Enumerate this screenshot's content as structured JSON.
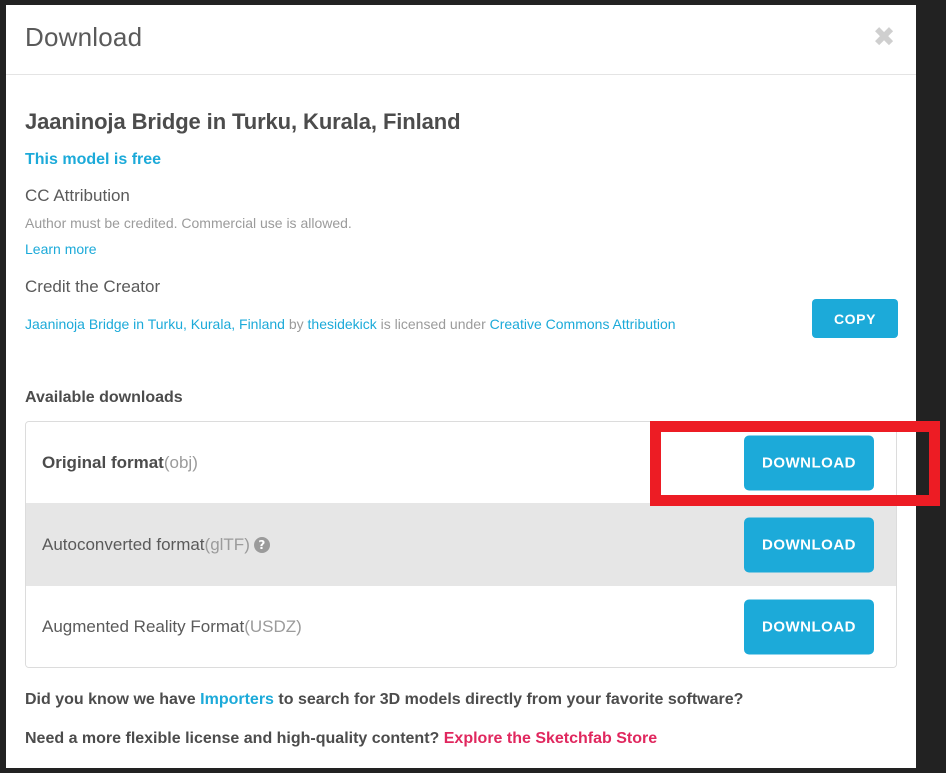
{
  "modal": {
    "title": "Download",
    "close_icon": "✖"
  },
  "model": {
    "title": "Jaaninoja Bridge in Turku, Kurala, Finland",
    "price_label": "This model is free"
  },
  "license": {
    "name": "CC Attribution",
    "description": "Author must be credited. Commercial use is allowed.",
    "learn_more": "Learn more"
  },
  "credit": {
    "heading": "Credit the Creator",
    "model_link": "Jaaninoja Bridge in Turku, Kurala, Finland",
    "by_text": " by ",
    "author_link": "thesidekick",
    "licensed_text": " is licensed under ",
    "license_link": "Creative Commons Attribution",
    "copy_label": "COPY"
  },
  "downloads": {
    "heading": "Available downloads",
    "rows": [
      {
        "name": "Original format",
        "format": "(obj)",
        "button_label": "DOWNLOAD",
        "has_help": false,
        "shaded": false
      },
      {
        "name": "Autoconverted format",
        "format": "(glTF)",
        "button_label": "DOWNLOAD",
        "has_help": true,
        "help_icon": "?",
        "shaded": true
      },
      {
        "name": "Augmented Reality Format",
        "format": "(USDZ)",
        "button_label": "DOWNLOAD",
        "has_help": false,
        "shaded": false
      }
    ]
  },
  "footer": {
    "line1_before": "Did you know we have ",
    "line1_link": "Importers",
    "line1_after": " to search for 3D models directly from your favorite software?",
    "line2_before": "Need a more flexible license and high-quality content? ",
    "line2_link": "Explore the Sketchfab Store"
  },
  "colors": {
    "accent_blue": "#1caad9",
    "store_pink": "#e0275e",
    "highlight_red": "#ed1c24",
    "page_background": "#222222",
    "row_shaded": "#e6e6e6"
  }
}
